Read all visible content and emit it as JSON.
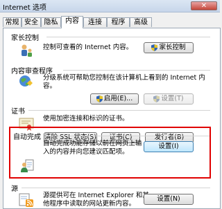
{
  "window": {
    "title": "Internet 选项",
    "close_glyph": "✕"
  },
  "tabs": [
    "常规",
    "安全",
    "隐私",
    "内容",
    "连接",
    "程序",
    "高级"
  ],
  "active_tab": "内容",
  "sections": {
    "parental": {
      "title": "家长控制",
      "description": "控制可查看的 Internet 内容。",
      "button": "家长控制"
    },
    "advisor": {
      "title": "内容审查程序",
      "description_line1": "分级系统可帮助您控制在该计算机上看到的 Internet 内",
      "description_line2": "容。",
      "enable_button": "启用(E)...",
      "settings_button": "设置(T)"
    },
    "certificates": {
      "title": "证书",
      "description": "使用加密连接和标识的证书。",
      "clear_ssl_button": "清除 SSL 状态(S)",
      "certificates_button": "证书(C)",
      "publishers_button": "发行者(B)"
    },
    "autocomplete": {
      "title": "自动完成",
      "description_line1": "自动完成功能存储以前在网页上输",
      "description_line2": "入的内容并向您建议匹配项。",
      "settings_button": "设置(I)"
    },
    "feeds": {
      "title": "源",
      "description_line1": "源提供可在 Internet Explorer 和其",
      "description_line2": "他程序中读取的网站更新内容。",
      "settings_button": "设置(N)"
    }
  },
  "colors": {
    "highlight": "#e00000",
    "focus_border": "#3c7fb1"
  }
}
